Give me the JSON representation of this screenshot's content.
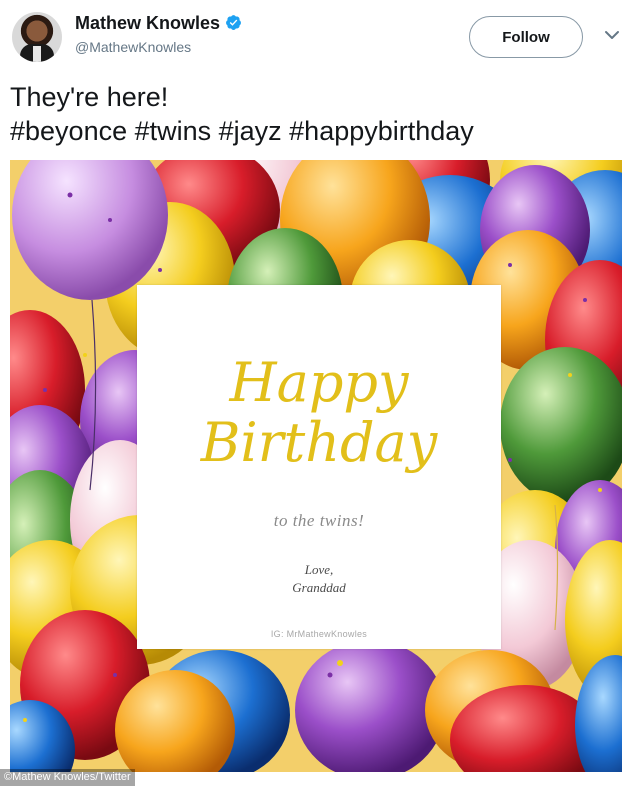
{
  "header": {
    "display_name": "Mathew Knowles",
    "handle": "@MathewKnowles",
    "follow_label": "Follow",
    "verified_color": "#1da1f2"
  },
  "tweet": {
    "line1": "They're here!",
    "line2": "#beyonce #twins #jayz #happybirthday"
  },
  "card": {
    "title_line1": "Happy",
    "title_line2": "Birthday",
    "subtitle": "to the twins!",
    "sign_line1": "Love,",
    "sign_line2": "Granddad",
    "instagram": "IG: MrMathewKnowles",
    "accent_color": "#e2bf1a"
  },
  "credit": "©Mathew Knowles/Twitter"
}
